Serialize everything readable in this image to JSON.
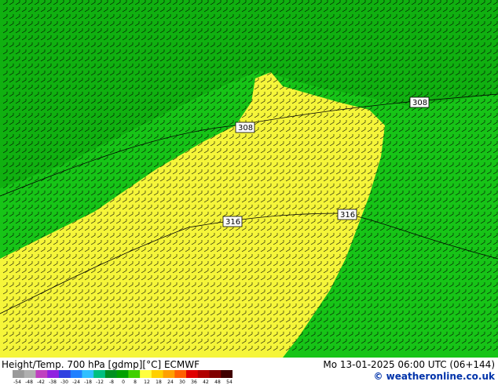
{
  "title": "Height/Temp. 700 hPa [gdmp][°C] ECMWF",
  "datetime": "Mo 13-01-2025 06:00 UTC (06+144)",
  "credit": "© weatheronline.co.uk",
  "contour_labels": [
    "308",
    "308",
    "316",
    "316"
  ],
  "legend": {
    "ticks": [
      "-54",
      "-48",
      "-42",
      "-38",
      "-30",
      "-24",
      "-18",
      "-12",
      "-8",
      "0",
      "8",
      "12",
      "18",
      "24",
      "30",
      "36",
      "42",
      "48",
      "54"
    ],
    "colors": [
      "#9a9a9a",
      "#b0b0b0",
      "#c040c0",
      "#9020e0",
      "#3040e0",
      "#2080ff",
      "#30c0ff",
      "#00c080",
      "#009020",
      "#00a000",
      "#40d000",
      "#ffff40",
      "#ffd000",
      "#ffa000",
      "#ff6000",
      "#e00000",
      "#b00000",
      "#800000",
      "#400000"
    ]
  },
  "colors": {
    "green_dark": "#0ea80e",
    "green": "#17c417",
    "yellow": "#f5f53a",
    "footer_credit": "#0033aa"
  }
}
